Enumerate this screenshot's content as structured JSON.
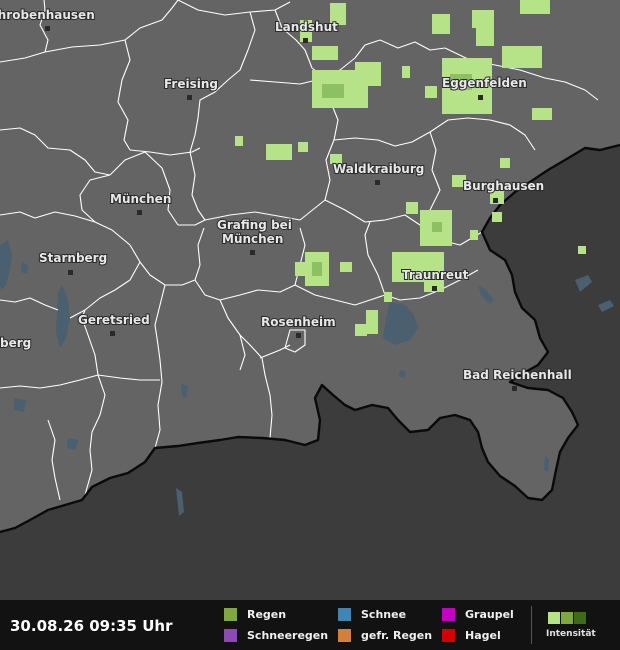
{
  "timestamp": "30.08.26 09:35 Uhr",
  "legend": {
    "items": [
      {
        "label": "Regen",
        "color": "#7fa843"
      },
      {
        "label": "Schneeregen",
        "color": "#8b4bb0"
      },
      {
        "label": "Schnee",
        "color": "#3f86b6"
      },
      {
        "label": "gefr. Regen",
        "color": "#d4803a"
      },
      {
        "label": "Graupel",
        "color": "#c400c4"
      },
      {
        "label": "Hagel",
        "color": "#d40000"
      }
    ],
    "intensity_label": "Intensität",
    "intensity_colors": [
      "#b6e388",
      "#7fa843",
      "#3d6b1a"
    ]
  },
  "cities": [
    {
      "name": "Schrobenhausen",
      "id": "schrobenhausen"
    },
    {
      "name": "Landshut",
      "id": "landshut"
    },
    {
      "name": "Freising",
      "id": "freising"
    },
    {
      "name": "Eggenfelden",
      "id": "eggenfelden"
    },
    {
      "name": "Waldkraiburg",
      "id": "waldkraiburg"
    },
    {
      "name": "Burghausen",
      "id": "burghausen"
    },
    {
      "name": "München",
      "id": "muenchen"
    },
    {
      "name": "Grafing bei",
      "id": "grafing-1"
    },
    {
      "name": "München",
      "id": "grafing-2"
    },
    {
      "name": "Starnberg",
      "id": "starnberg"
    },
    {
      "name": "Traunreut",
      "id": "traunreut"
    },
    {
      "name": "Geretsried",
      "id": "geretsried"
    },
    {
      "name": "Rosenheim",
      "id": "rosenheim"
    },
    {
      "name": "Bad Reichenhall",
      "id": "bad-reichenhall"
    },
    {
      "name": "berg",
      "id": "berg"
    }
  ],
  "colors": {
    "land_bavaria": "#646464",
    "land_outside": "#3c3c3c",
    "border": "#ffffff",
    "water": "#4a5f70",
    "rain_light": "#b6e388",
    "rain_medium": "#8dc063"
  }
}
